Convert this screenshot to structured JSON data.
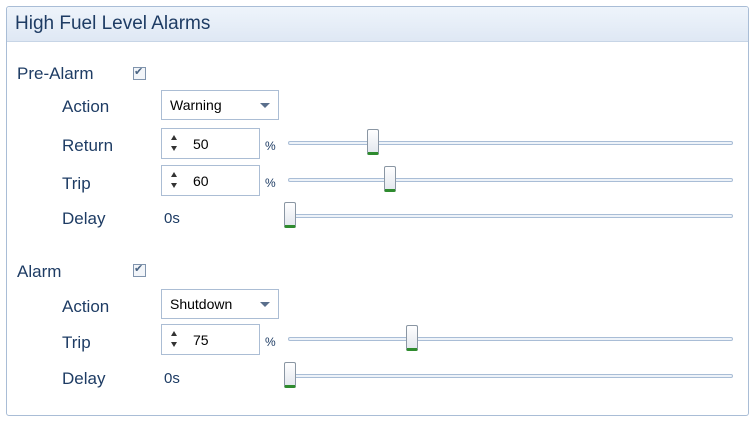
{
  "panel": {
    "title": "High Fuel Level Alarms"
  },
  "pre_alarm": {
    "label": "Pre-Alarm",
    "checked": true,
    "action_label": "Action",
    "action_value": "Warning",
    "return_label": "Return",
    "return_value": "50",
    "return_unit": "%",
    "trip_label": "Trip",
    "trip_value": "60",
    "trip_unit": "%",
    "delay_label": "Delay",
    "delay_value": "0s"
  },
  "alarm": {
    "label": "Alarm",
    "checked": true,
    "action_label": "Action",
    "action_value": "Shutdown",
    "trip_label": "Trip",
    "trip_value": "75",
    "trip_unit": "%",
    "delay_label": "Delay",
    "delay_value": "0s"
  },
  "colors": {
    "accent": "#1e3c64",
    "thumb_indicator": "#2e8b2e"
  }
}
